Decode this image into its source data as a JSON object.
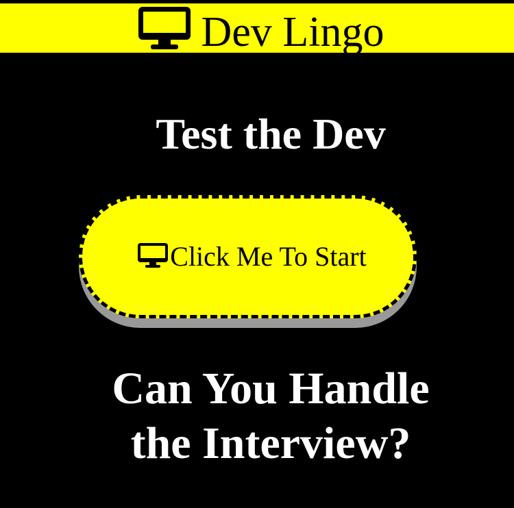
{
  "header": {
    "icon": "desktop-monitor-icon",
    "title": "Dev Lingo"
  },
  "main": {
    "headline": "Test the Dev",
    "start_button": {
      "icon": "desktop-monitor-icon",
      "label": "Click Me To Start"
    },
    "tagline_line1": "Can You Handle",
    "tagline_line2": "the Interview?"
  },
  "colors": {
    "background": "#000000",
    "accent": "#ffff00",
    "text": "#ffffff",
    "button_shadow": "#999999"
  }
}
